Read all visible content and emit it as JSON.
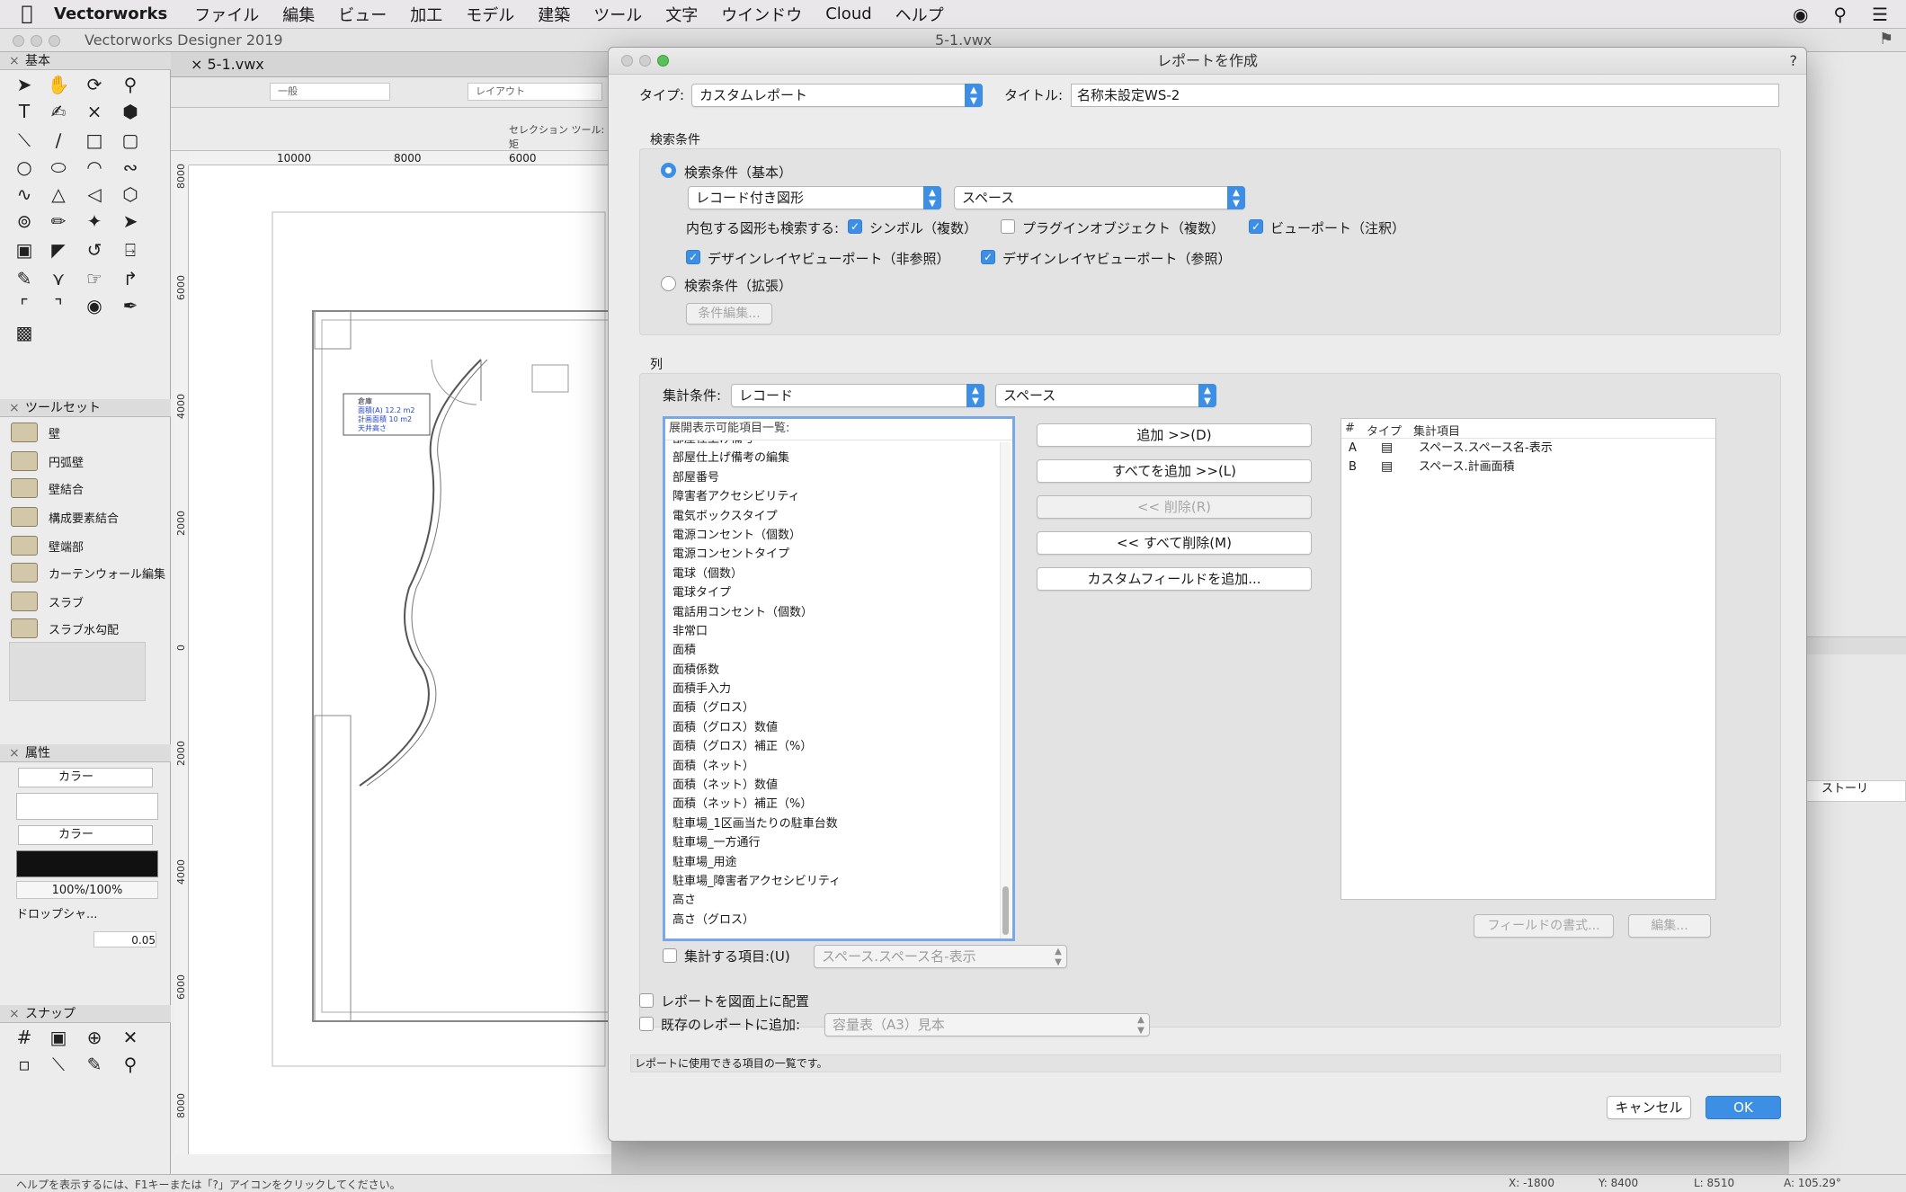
{
  "menubar": {
    "app": "Vectorworks",
    "items": [
      "ファイル",
      "編集",
      "ビュー",
      "加工",
      "モデル",
      "建築",
      "ツール",
      "文字",
      "ウインドウ",
      "Cloud",
      "ヘルプ"
    ]
  },
  "app_window": {
    "title": "Vectorworks Designer 2019",
    "doc_title": "5-1.vwx",
    "tab": "5-1.vwx",
    "view_class": "一般",
    "layer": "レイアウト",
    "mode_text": "セレクション ツール: 矩",
    "ruler_ticks": [
      "10000",
      "8000",
      "6000"
    ],
    "vruler_ticks": [
      "8000",
      "6000",
      "4000",
      "2000",
      "0",
      "2000",
      "4000",
      "6000",
      "8000"
    ]
  },
  "palettes": {
    "basic": "基本",
    "toolset": "ツールセット",
    "toolset_items": [
      "壁",
      "円弧壁",
      "壁結合",
      "構成要素結合",
      "壁端部",
      "カーテンウォール編集",
      "スラブ",
      "スラブ水勾配"
    ],
    "attributes": "属性",
    "fill_label": "カラー",
    "pen_label": "カラー",
    "opacity": "100%/100%",
    "drop_shadow": "ドロップシャ...",
    "line_weight": "0.05",
    "snap": "スナップ"
  },
  "drawing_tag": {
    "line1": "倉庫",
    "line2": "面積(A) 12.2 m2",
    "line3": "計画面積 10 m2",
    "line4": "天井高さ"
  },
  "right_panel": {
    "story_label": "ストーリ"
  },
  "statusbar": {
    "help": "ヘルプを表示するには、F1キーまたは「?」アイコンをクリックしてください。",
    "x": "X: -1800",
    "y": "Y: 8400",
    "l": "L: 8510",
    "a": "A: 105.29°"
  },
  "dialog": {
    "title": "レポートを作成",
    "help": "?",
    "type_label": "タイプ:",
    "type_value": "カスタムレポート",
    "title_label": "タイトル:",
    "title_value": "名称未設定WS-2",
    "search_section": "検索条件",
    "search_basic": "検索条件（基本）",
    "search_target": "レコード付き図形",
    "search_record": "スペース",
    "include_label": "内包する図形も検索する:",
    "cb_symbol": "シンボル（複数）",
    "cb_plugin": "プラグインオブジェクト（複数）",
    "cb_viewport": "ビューポート（注釈）",
    "cb_dlvp_nonref": "デザインレイヤビューポート（非参照）",
    "cb_dlvp_ref": "デザインレイヤビューポート（参照）",
    "search_ext": "検索条件（拡張）",
    "edit_cond": "条件編集...",
    "columns_section": "列",
    "aggregate_label": "集計条件:",
    "aggregate_value": "レコード",
    "aggregate_record": "スペース",
    "available_header": "展開表示可能項目一覧:",
    "available_items": [
      "部屋仕上げ備考",
      "部屋仕上げ備考の編集",
      "部屋番号",
      "障害者アクセシビリティ",
      "電気ボックスタイプ",
      "電源コンセント（個数）",
      "電源コンセントタイプ",
      "電球（個数）",
      "電球タイプ",
      "電話用コンセント（個数）",
      "非常口",
      "面積",
      "面積係数",
      "面積手入力",
      "面積（グロス）",
      "面積（グロス）数値",
      "面積（グロス）補正（%）",
      "面積（ネット）",
      "面積（ネット）数値",
      "面積（ネット）補正（%）",
      "駐車場_1区画当たりの駐車台数",
      "駐車場_一方通行",
      "駐車場_用途",
      "駐車場_障害者アクセシビリティ",
      "高さ",
      "高さ（グロス）"
    ],
    "btn_add": "追加 >>(D)",
    "btn_add_all": "すべてを追加 >>(L)",
    "btn_remove": "<< 削除(R)",
    "btn_remove_all": "<< すべて削除(M)",
    "btn_custom": "カスタムフィールドを追加...",
    "selected_headers": [
      "#",
      "タイプ",
      "集計項目"
    ],
    "selected_rows": [
      {
        "id": "A",
        "item": "スペース.スペース名-表示"
      },
      {
        "id": "B",
        "item": "スペース.計画面積"
      }
    ],
    "btn_format": "フィールドの書式...",
    "btn_edit": "編集...",
    "summarize_label": "集計する項目:(U)",
    "summarize_value": "スペース.スペース名-表示",
    "place_on_drawing": "レポートを図面上に配置",
    "add_existing": "既存のレポートに追加:",
    "existing_value": "容量表（A3）見本",
    "help_text": "レポートに使用できる項目の一覧です。",
    "cancel": "キャンセル",
    "ok": "OK"
  },
  "colors": {
    "accent": "#3d8fe6",
    "dialog_bg": "#ececec"
  }
}
